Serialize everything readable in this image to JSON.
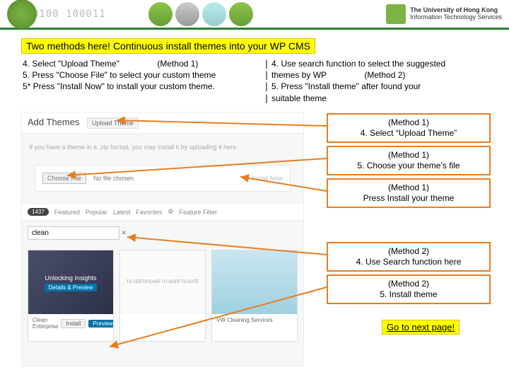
{
  "header": {
    "binary": "0100       100011",
    "brand_line1": "The University of Hong Kong",
    "brand_line2": "Information Technology Services"
  },
  "title": "Two methods here! Continuous install themes into your WP CMS",
  "left_col": {
    "l1a": "4. Select \"Upload Theme\"",
    "l1b": "(Method 1)",
    "l2": "5. Press \"Choose File\" to select your custom theme",
    "l3": "5* Press \"Install Now\" to install your custom theme."
  },
  "sep": "|\n|\n|\n|",
  "right_col": {
    "l1": "4. Use search function to select the suggested",
    "l2a": "themes by WP",
    "l2b": "(Method 2)",
    "l3": "5. Press \"Install theme\" after found your",
    "l4": "suitable theme"
  },
  "wp": {
    "add_themes": "Add Themes",
    "upload_tab": "Upload Theme",
    "note": "If you have a theme in a .zip format, you may install it by uploading it here.",
    "choose": "Choose File",
    "nofile": "No file chosen",
    "install_now": "Install Now",
    "badge": "1437",
    "filters": [
      "Featured",
      "Popular",
      "Latest",
      "Favorites",
      "Feature Filter"
    ],
    "search_value": "clean",
    "card1_title": "Unlocking Insights",
    "card1_btn": "Details & Preview",
    "card1_name": "Clean Enterprise",
    "card2_title": "TS CERTIFICANT UT ADEP TO EATE",
    "card3_name": "VW Cleaning Services",
    "install": "Install",
    "preview": "Preview"
  },
  "callouts": {
    "c1a": "(Method 1)",
    "c1b": "4. Select “Upload Theme”",
    "c2a": "(Method 1)",
    "c2b": "5. Choose your theme’s file",
    "c3a": "(Method 1)",
    "c3b": "Press Install your theme",
    "c4a": "(Method 2)",
    "c4b": "4. Use Search function here",
    "c5a": "(Method 2)",
    "c5b": "5. Install theme"
  },
  "next": "Go to next page!"
}
